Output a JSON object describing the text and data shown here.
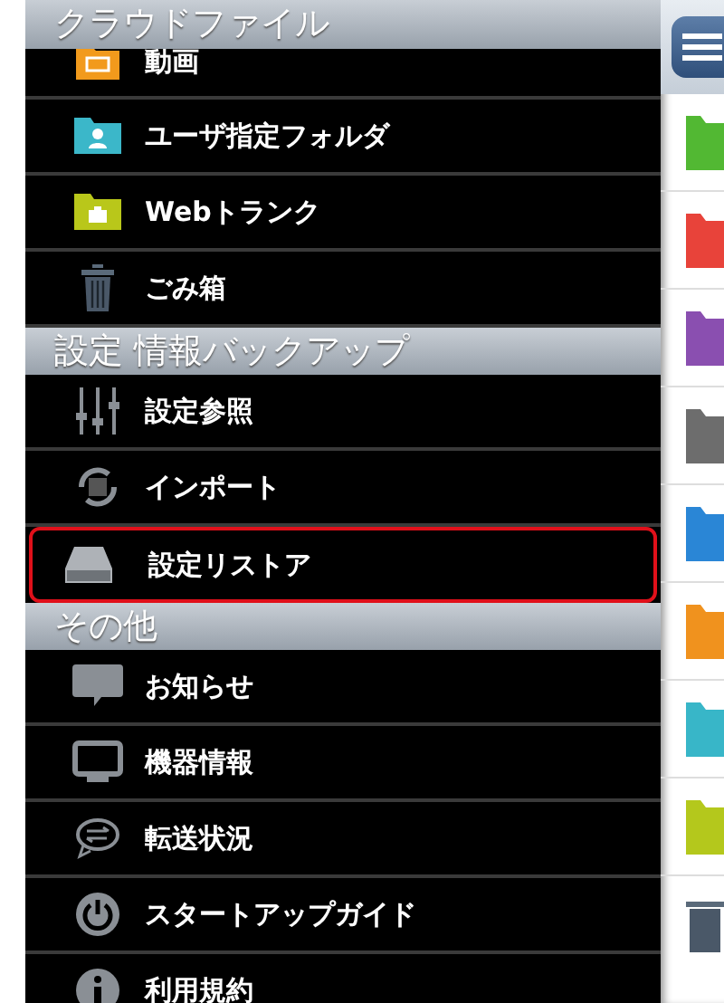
{
  "sections": [
    {
      "title": "クラウドファイル",
      "items": [
        {
          "label": "動画",
          "kind": "video",
          "selected": false
        },
        {
          "label": "ユーザ指定フォルダ",
          "kind": "user-folder",
          "selected": false
        },
        {
          "label": "Webトランク",
          "kind": "briefcase-folder",
          "selected": false
        },
        {
          "label": "ごみ箱",
          "kind": "trash",
          "selected": false
        }
      ]
    },
    {
      "title": "設定 情報バックアップ",
      "items": [
        {
          "label": "設定参照",
          "kind": "sliders",
          "selected": false
        },
        {
          "label": "インポート",
          "kind": "import",
          "selected": false
        },
        {
          "label": "設定リストア",
          "kind": "drive",
          "selected": true
        }
      ]
    },
    {
      "title": "その他",
      "items": [
        {
          "label": "お知らせ",
          "kind": "message",
          "selected": false
        },
        {
          "label": "機器情報",
          "kind": "monitor",
          "selected": false
        },
        {
          "label": "転送状況",
          "kind": "transfer",
          "selected": false
        },
        {
          "label": "スタートアップガイド",
          "kind": "power",
          "selected": false
        },
        {
          "label": "利用規約",
          "kind": "info",
          "selected": false
        }
      ]
    }
  ]
}
